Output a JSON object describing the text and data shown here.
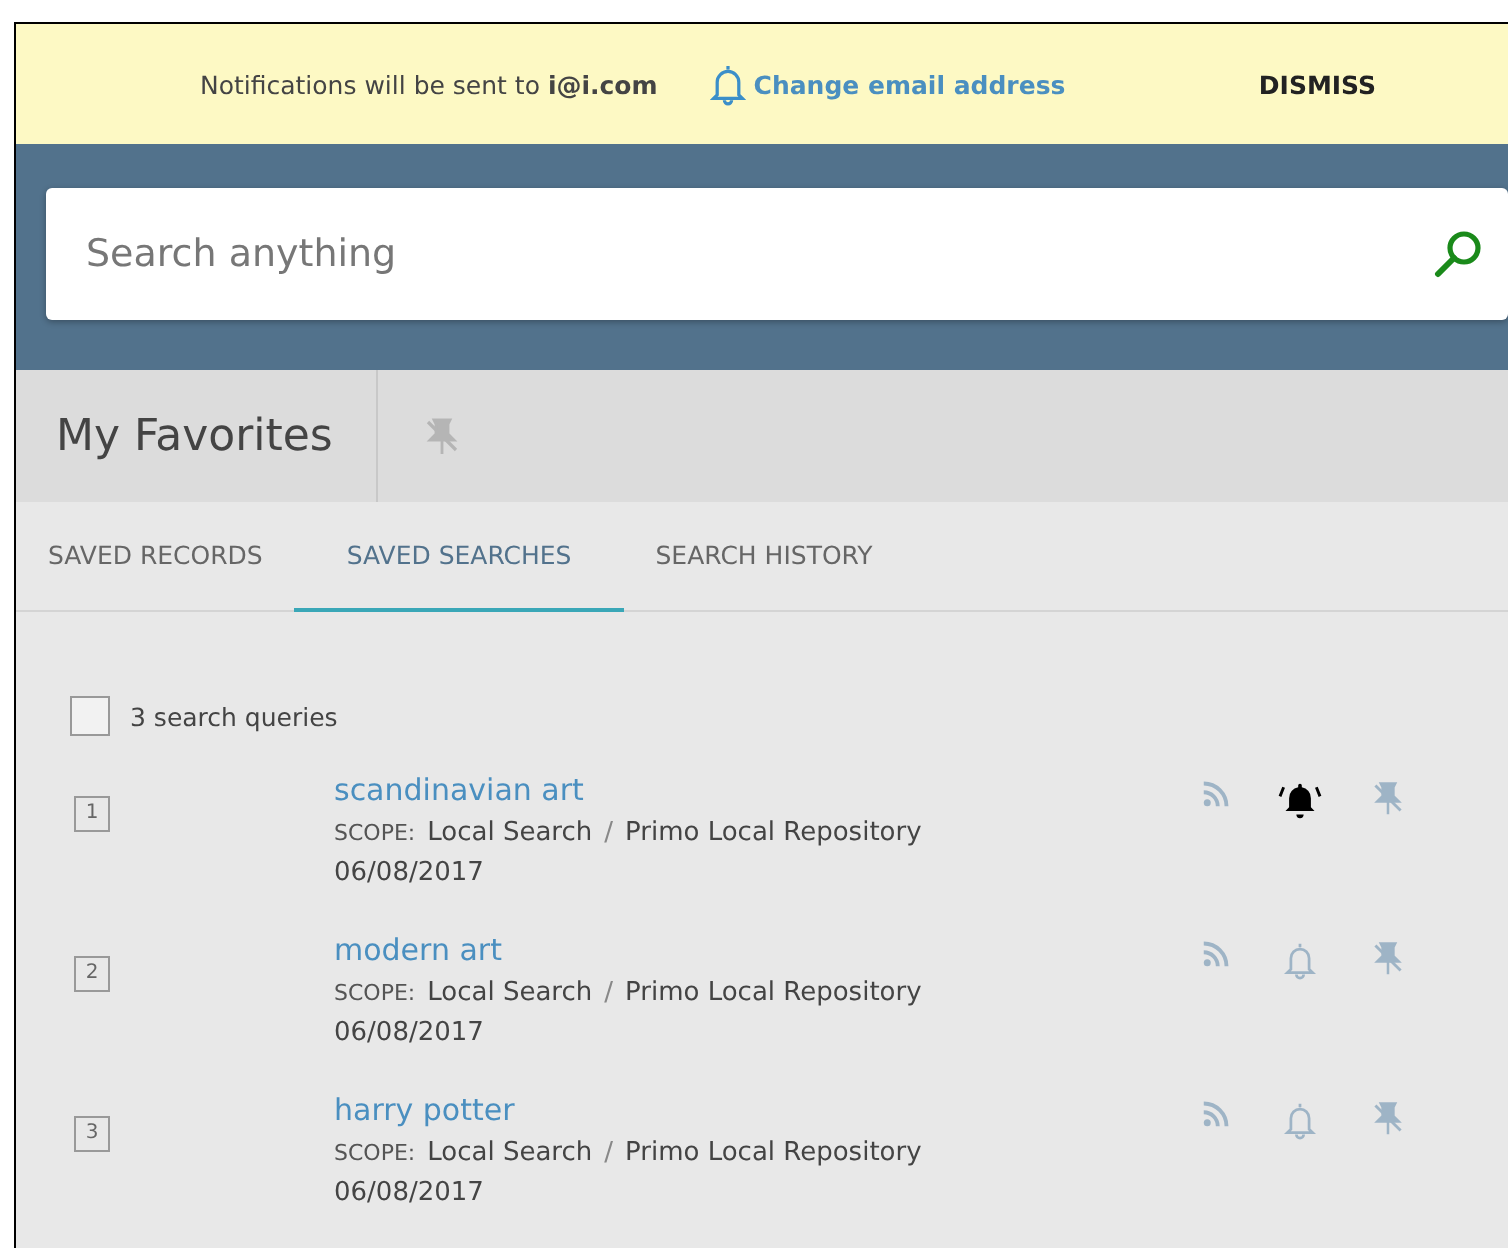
{
  "banner": {
    "message": "Notifications will be sent to **i@i.com**",
    "link": "Change email address",
    "dismiss": "DISMISS"
  },
  "search": {
    "placeholder": "Search anything"
  },
  "favorites": {
    "title": "My Favorites"
  },
  "tabs": [
    {
      "label": "SAVED RECORDS",
      "selected": false
    },
    {
      "label": "SAVED SEARCHES",
      "selected": true
    },
    {
      "label": "SEARCH HISTORY",
      "selected": false
    }
  ],
  "select_all": {
    "label": "3 search queries",
    "checked": false
  },
  "queries": [
    {
      "number": "1",
      "title": "scandinavian art",
      "scope_label": "SCOPE:",
      "scope": "Local Search",
      "separator": "/",
      "repository": "Primo Local Repository",
      "date": "06/08/2017",
      "alert_on": true
    },
    {
      "number": "2",
      "title": "modern art",
      "scope_label": "SCOPE:",
      "scope": "Local Search",
      "separator": "/",
      "repository": "Primo Local Repository",
      "date": "06/08/2017",
      "alert_on": false
    },
    {
      "number": "3",
      "title": "harry potter",
      "scope_label": "SCOPE:",
      "scope": "Local Search",
      "separator": "/",
      "repository": "Primo Local Repository",
      "date": "06/08/2017",
      "alert_on": false
    }
  ]
}
